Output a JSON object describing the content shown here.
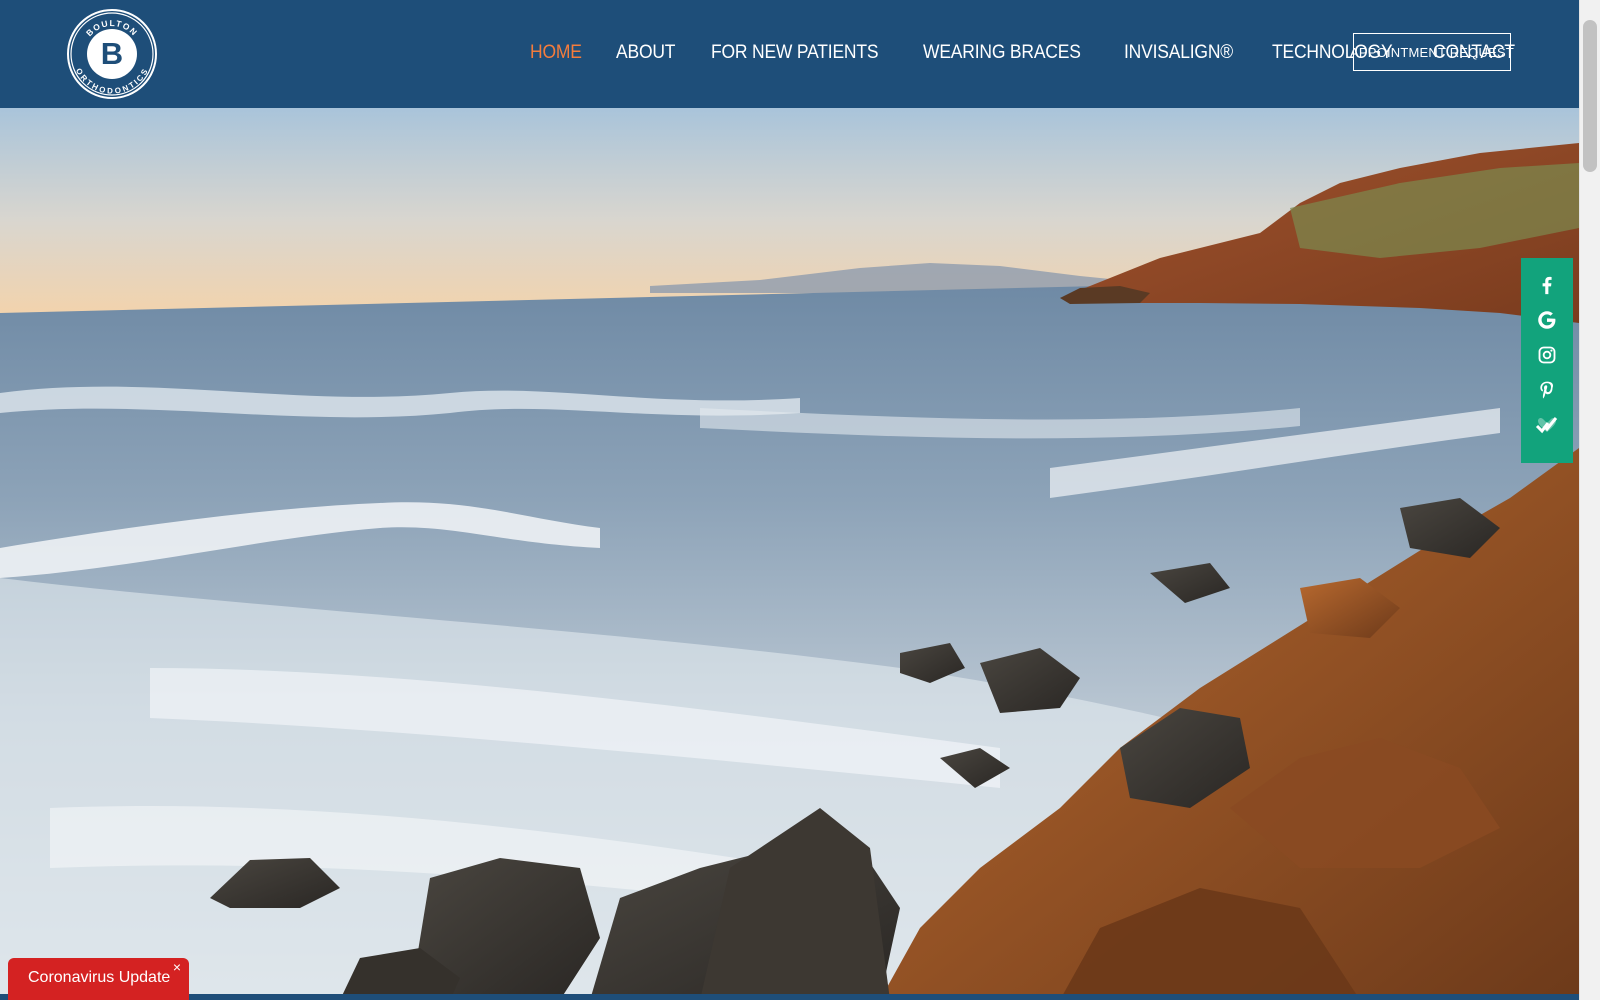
{
  "header": {
    "logo": {
      "top_text": "BOULTON",
      "bottom_text": "ORTHODONTICS",
      "letter": "B"
    },
    "nav": [
      {
        "label": "HOME",
        "active": true
      },
      {
        "label": "ABOUT",
        "active": false
      },
      {
        "label": "FOR NEW PATIENTS",
        "active": false
      },
      {
        "label": "WEARING BRACES",
        "active": false
      },
      {
        "label": "INVISALIGN®",
        "active": false
      },
      {
        "label": "TECHNOLOGY",
        "active": false
      },
      {
        "label": "CONTACT",
        "active": false
      }
    ],
    "cta_label": "APPOINTMENT REQUEST"
  },
  "social": [
    {
      "icon": "facebook-icon"
    },
    {
      "icon": "google-icon"
    },
    {
      "icon": "instagram-icon"
    },
    {
      "icon": "pinterest-icon"
    },
    {
      "icon": "healthgrades-icon"
    }
  ],
  "covid_banner": {
    "label": "Coronavirus Update",
    "close": "×"
  },
  "colors": {
    "header_bg": "#1e4e79",
    "nav_active": "#f47c3c",
    "social_bg": "#12a37c",
    "covid_bg": "#d42222"
  }
}
